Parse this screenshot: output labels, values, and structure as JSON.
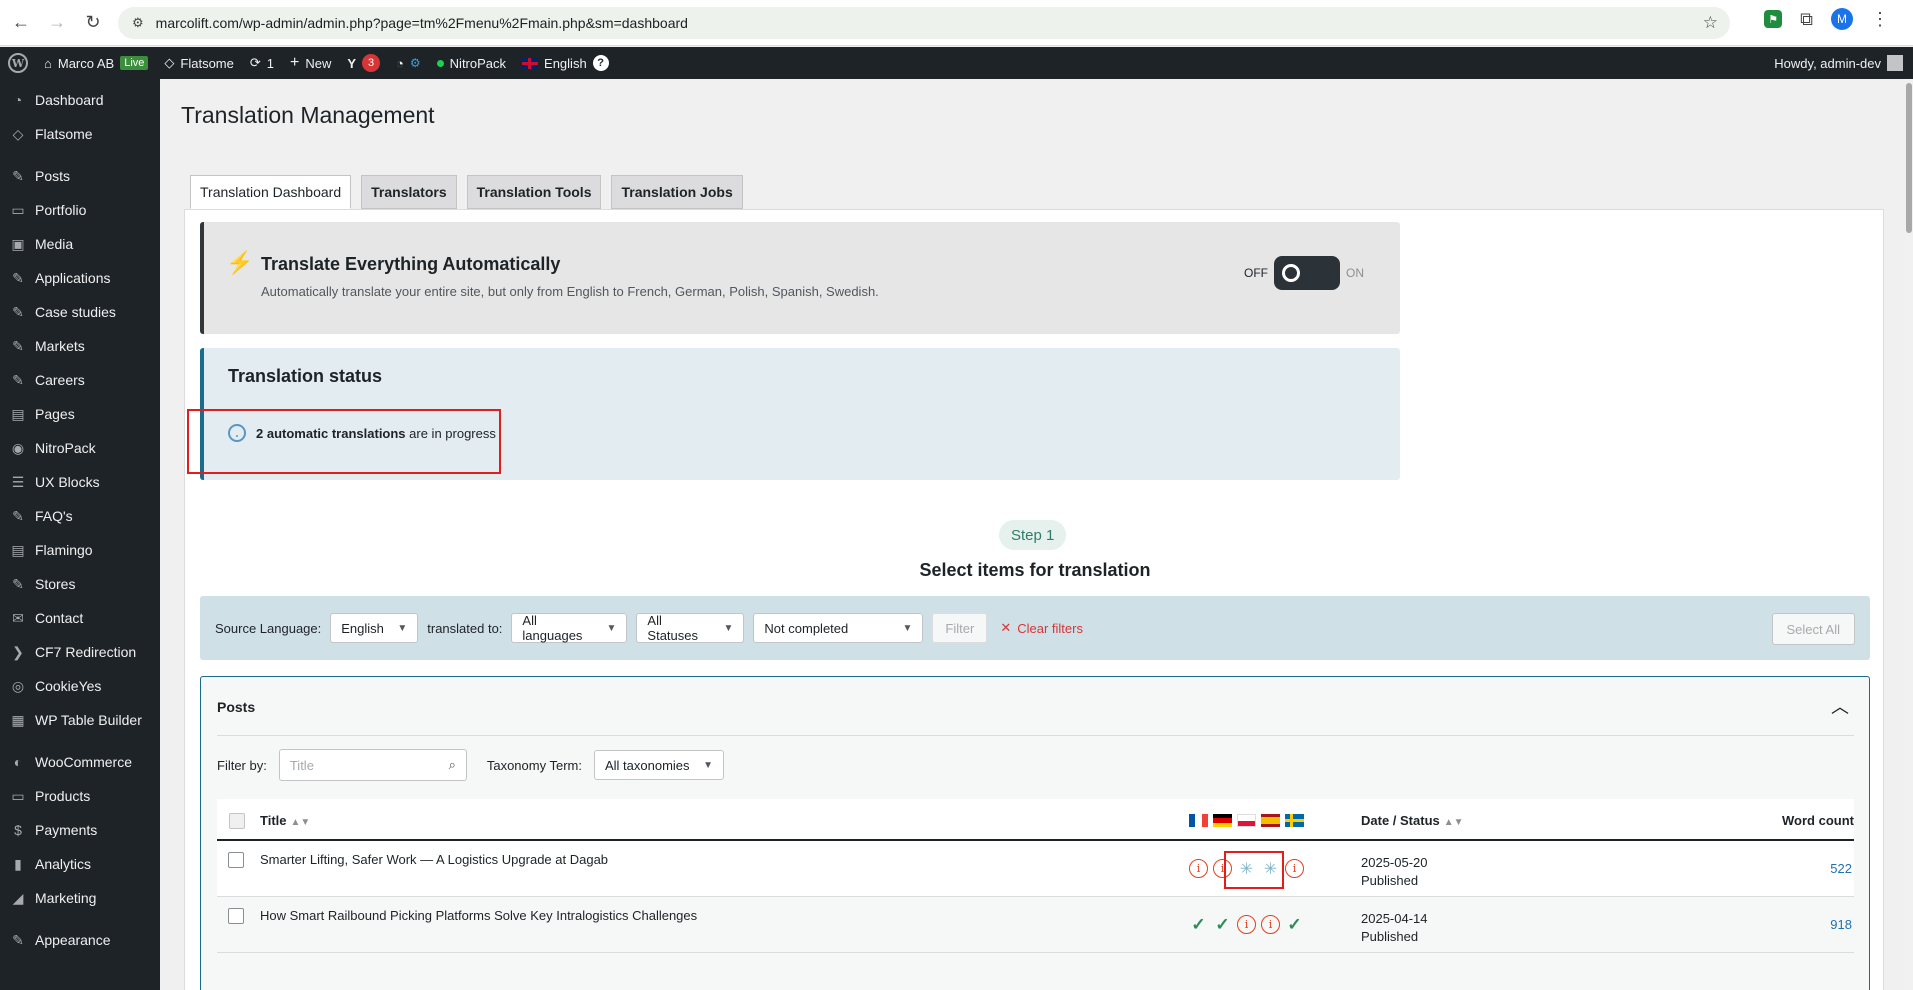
{
  "browser": {
    "url": "marcolift.com/wp-admin/admin.php?page=tm%2Fmenu%2Fmain.php&sm=dashboard",
    "profile_initial": "M"
  },
  "adminbar": {
    "site_name": "Marco AB",
    "live_label": "Live",
    "theme": "Flatsome",
    "updates_count": "1",
    "new_label": "New",
    "yoast_count": "3",
    "nitropack_label": "NitroPack",
    "language_label": "English",
    "help_glyph": "?",
    "howdy": "Howdy, admin-dev"
  },
  "sidebar": {
    "items": [
      {
        "label": "Dashboard",
        "icon": "dashboard-icon",
        "glyph": "◔"
      },
      {
        "label": "Flatsome",
        "icon": "flatsome-icon",
        "glyph": "◇"
      },
      {
        "label": "Posts",
        "icon": "pin-icon",
        "glyph": "✎"
      },
      {
        "label": "Portfolio",
        "icon": "portfolio-icon",
        "glyph": "▭"
      },
      {
        "label": "Media",
        "icon": "media-icon",
        "glyph": "▣"
      },
      {
        "label": "Applications",
        "icon": "pin-icon",
        "glyph": "✎"
      },
      {
        "label": "Case studies",
        "icon": "pin-icon",
        "glyph": "✎"
      },
      {
        "label": "Markets",
        "icon": "pin-icon",
        "glyph": "✎"
      },
      {
        "label": "Careers",
        "icon": "pin-icon",
        "glyph": "✎"
      },
      {
        "label": "Pages",
        "icon": "pages-icon",
        "glyph": "▤"
      },
      {
        "label": "NitroPack",
        "icon": "nitropack-icon",
        "glyph": "◉"
      },
      {
        "label": "UX Blocks",
        "icon": "blocks-icon",
        "glyph": "☰"
      },
      {
        "label": "FAQ's",
        "icon": "pin-icon",
        "glyph": "✎"
      },
      {
        "label": "Flamingo",
        "icon": "flamingo-icon",
        "glyph": "▤"
      },
      {
        "label": "Stores",
        "icon": "pin-icon",
        "glyph": "✎"
      },
      {
        "label": "Contact",
        "icon": "mail-icon",
        "glyph": "✉"
      },
      {
        "label": "CF7 Redirection",
        "icon": "redirect-icon",
        "glyph": "❯"
      },
      {
        "label": "CookieYes",
        "icon": "cookie-icon",
        "glyph": "◎"
      },
      {
        "label": "WP Table Builder",
        "icon": "table-icon",
        "glyph": "▦"
      },
      {
        "label": "WooCommerce",
        "icon": "woo-icon",
        "glyph": "◐"
      },
      {
        "label": "Products",
        "icon": "products-icon",
        "glyph": "▭"
      },
      {
        "label": "Payments",
        "icon": "payments-icon",
        "glyph": "$"
      },
      {
        "label": "Analytics",
        "icon": "analytics-icon",
        "glyph": "▮"
      },
      {
        "label": "Marketing",
        "icon": "marketing-icon",
        "glyph": "◢"
      },
      {
        "label": "Appearance",
        "icon": "appearance-icon",
        "glyph": "✎"
      }
    ]
  },
  "page": {
    "title": "Translation Management",
    "tabs": [
      "Translation Dashboard",
      "Translators",
      "Translation Tools",
      "Translation Jobs"
    ]
  },
  "tea": {
    "title": "Translate Everything Automatically",
    "subtitle": "Automatically translate your entire site, but only from English to French, German, Polish, Spanish, Swedish.",
    "off_label": "OFF",
    "on_label": "ON"
  },
  "status": {
    "title": "Translation status",
    "bold_text": "2 automatic translations",
    "rest_text": " are in progress"
  },
  "step": {
    "pill": "Step 1",
    "title": "Select items for translation"
  },
  "filters": {
    "source_label": "Source Language:",
    "source_value": "English",
    "translated_label": "translated to:",
    "languages_value": "All languages",
    "statuses_value": "All Statuses",
    "completion_value": "Not completed",
    "filter_button": "Filter",
    "clear_label": "Clear filters",
    "select_all": "Select All"
  },
  "posts": {
    "heading": "Posts",
    "filter_by_label": "Filter by:",
    "title_placeholder": "Title",
    "taxonomy_label": "Taxonomy Term:",
    "taxonomy_value": "All taxonomies",
    "columns": {
      "title": "Title",
      "date": "Date / Status",
      "words": "Word count"
    },
    "rows": [
      {
        "title": "Smarter Lifting, Safer Work — A Logistics Upgrade at Dagab",
        "date": "2025-05-20",
        "status": "Published",
        "words": "522",
        "languages": [
          "needs-translation",
          "needs-translation",
          "in-progress",
          "in-progress",
          "needs-translation"
        ]
      },
      {
        "title": "How Smart Railbound Picking Platforms Solve Key Intralogistics Challenges",
        "date": "2025-04-14",
        "status": "Published",
        "words": "918",
        "languages": [
          "complete",
          "complete",
          "needs-translation",
          "needs-translation",
          "complete"
        ]
      }
    ]
  },
  "colors": {
    "admin_dark": "#1d2327",
    "accent_blue": "#2271b1",
    "warning_red": "#e2401c",
    "complete_green": "#2e8b57",
    "highlight_red": "#e01e1e"
  }
}
